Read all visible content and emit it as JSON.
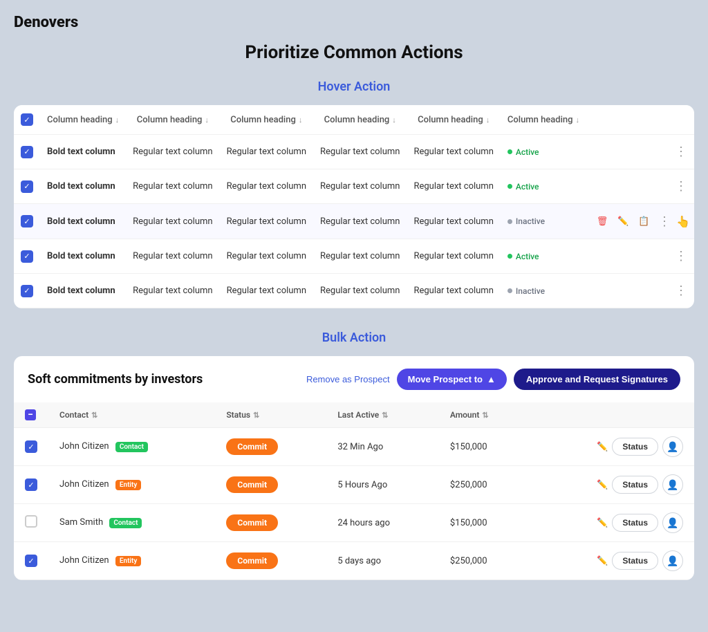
{
  "app": {
    "title": "Denovers"
  },
  "page": {
    "title": "Prioritize Common Actions"
  },
  "hover_section": {
    "label": "Hover Action",
    "table": {
      "columns": [
        "Column heading",
        "Column heading",
        "Column heading",
        "Column heading",
        "Column heading",
        "Column heading"
      ],
      "rows": [
        {
          "checked": true,
          "col1": "Bold text column",
          "col2": "Regular text column",
          "col3": "Regular text column",
          "col4": "Regular text column",
          "col5": "Regular text column",
          "status": "Active",
          "status_type": "active",
          "show_actions": false
        },
        {
          "checked": true,
          "col1": "Bold text column",
          "col2": "Regular text column",
          "col3": "Regular text column",
          "col4": "Regular text column",
          "col5": "Regular text column",
          "status": "Active",
          "status_type": "active",
          "show_actions": false
        },
        {
          "checked": true,
          "col1": "Bold text column",
          "col2": "Regular text column",
          "col3": "Regular text column",
          "col4": "Regular text column",
          "col5": "Regular text column",
          "status": "Inactive",
          "status_type": "inactive",
          "show_actions": true
        },
        {
          "checked": true,
          "col1": "Bold text column",
          "col2": "Regular text column",
          "col3": "Regular text column",
          "col4": "Regular text column",
          "col5": "Regular text column",
          "status": "Active",
          "status_type": "active",
          "show_actions": false
        },
        {
          "checked": true,
          "col1": "Bold text column",
          "col2": "Regular text column",
          "col3": "Regular text column",
          "col4": "Regular text column",
          "col5": "Regular text column",
          "status": "Inactive",
          "status_type": "inactive",
          "show_actions": false
        }
      ]
    }
  },
  "bulk_section": {
    "label": "Bulk Action",
    "table_title": "Soft commitments by investors",
    "remove_label": "Remove as Prospect",
    "move_label": "Move Prospect to",
    "approve_label": "Approve and Request Signatures",
    "columns": {
      "contact": "Contact",
      "status": "Status",
      "last_active": "Last Active",
      "amount": "Amount"
    },
    "rows": [
      {
        "checked": true,
        "name": "John Citizen",
        "tag": "Contact",
        "tag_type": "contact",
        "status": "Commit",
        "last_active": "32 Min Ago",
        "amount": "$150,000"
      },
      {
        "checked": true,
        "name": "John Citizen",
        "tag": "Entity",
        "tag_type": "entity",
        "status": "Commit",
        "last_active": "5 Hours Ago",
        "amount": "$250,000"
      },
      {
        "checked": false,
        "name": "Sam Smith",
        "tag": "Contact",
        "tag_type": "contact",
        "status": "Commit",
        "last_active": "24 hours ago",
        "amount": "$150,000"
      },
      {
        "checked": true,
        "name": "John Citizen",
        "tag": "Entity",
        "tag_type": "entity",
        "status": "Commit",
        "last_active": "5 days ago",
        "amount": "$250,000"
      }
    ]
  }
}
